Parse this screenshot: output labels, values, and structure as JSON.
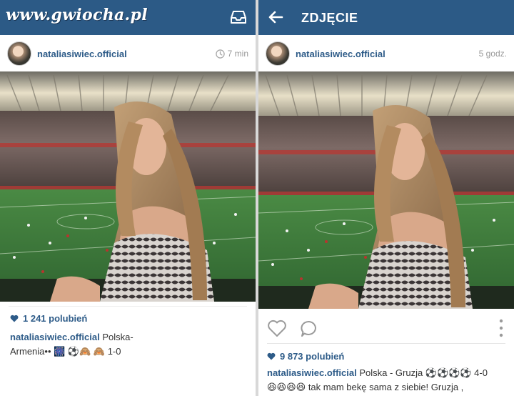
{
  "left": {
    "brand": "www.gwiocha.pl",
    "inbox_icon": "inbox-icon",
    "post": {
      "username": "nataliasiwiec.official",
      "time": "7 min",
      "likes": "1 241 polubień",
      "caption_user": "nataliasiwiec.official",
      "caption_text": " Polska-Armenia•• ",
      "caption_emoji": "🎆 ⚽🙈 🙈 1-0"
    }
  },
  "right": {
    "title": "ZDJĘCIE",
    "back_icon": "back-arrow-icon",
    "post": {
      "username": "nataliasiwiec.official",
      "time": "5 godz.",
      "likes": "9 873 polubień",
      "caption_user": "nataliasiwiec.official",
      "caption_text": " Polska - Gruzja ",
      "caption_balls": "⚽⚽⚽⚽",
      "caption_score": " 4-0",
      "caption_line2": "😆😆😆😆 tak mam bekę sama z siebie! Gruzja ,"
    }
  },
  "colors": {
    "topbar": "#2c5a86",
    "username": "#2d5b88",
    "pitch": "#3e7a3a",
    "roof": "#e8e0c8"
  }
}
